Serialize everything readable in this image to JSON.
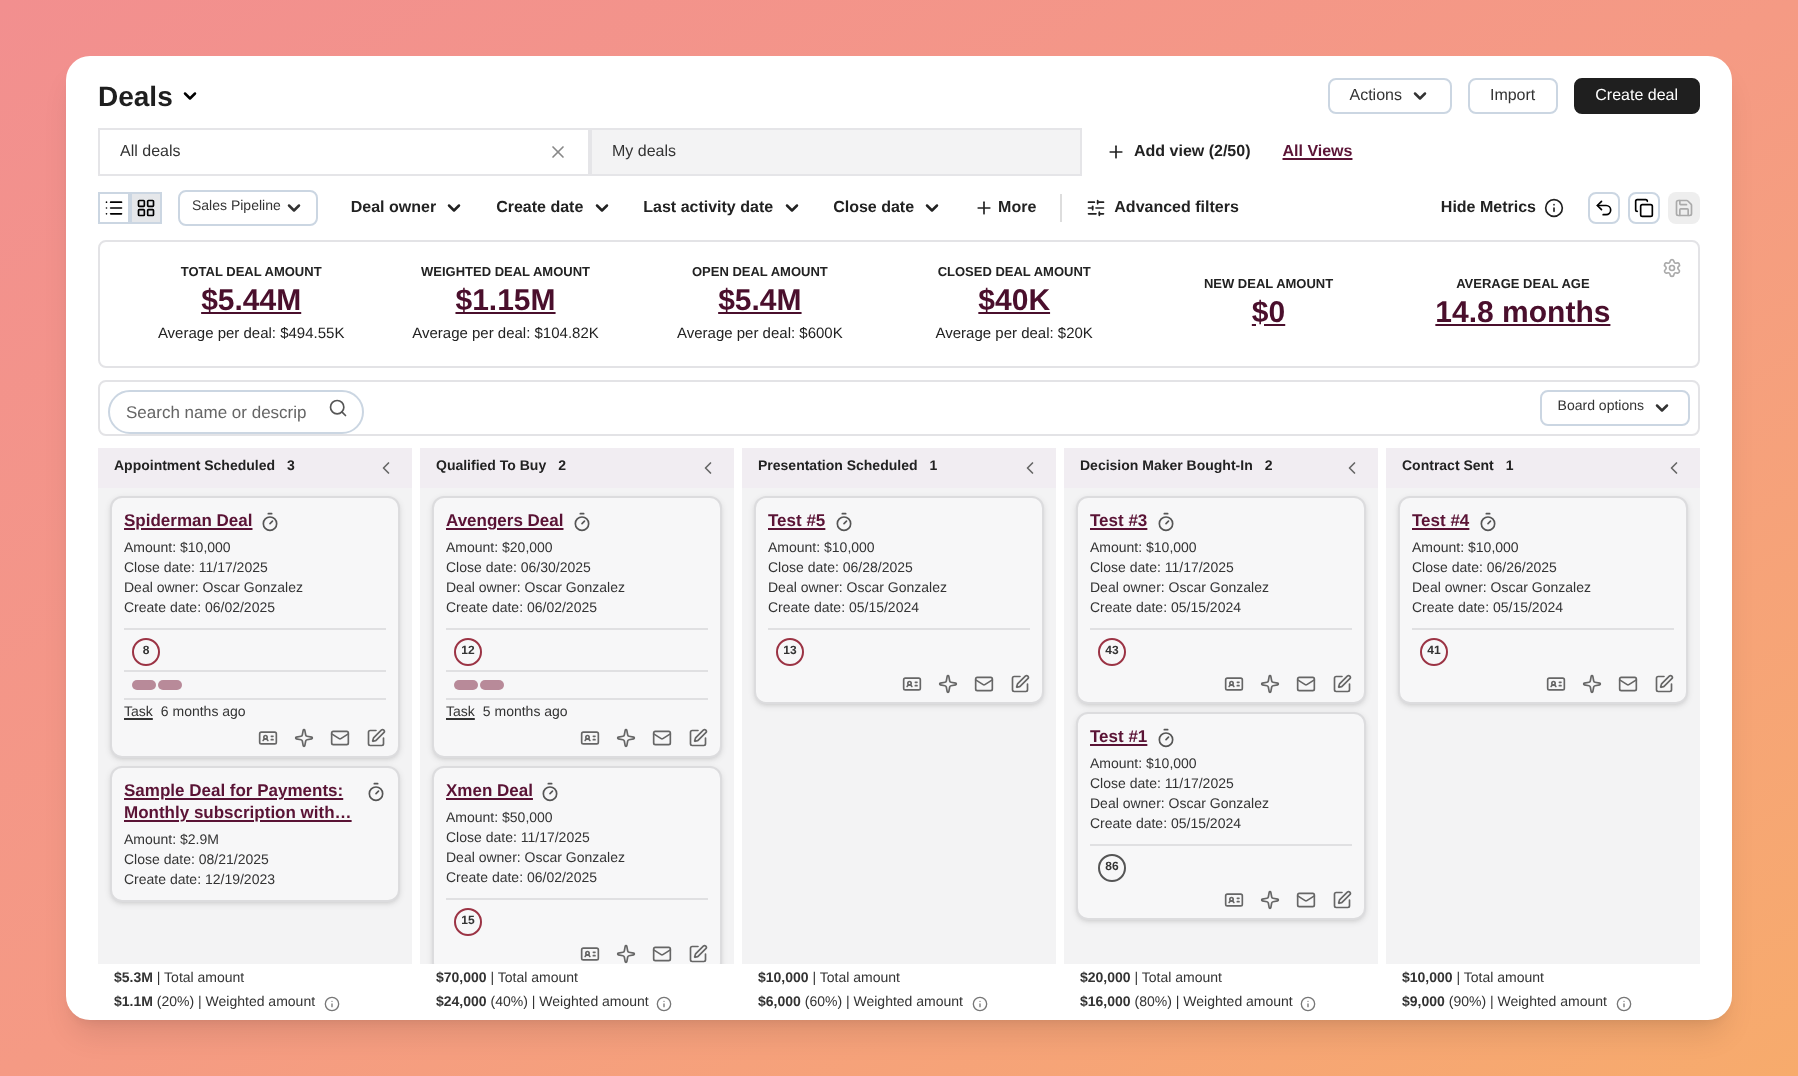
{
  "header": {
    "title": "Deals",
    "buttons": [
      {
        "label": "Actions",
        "kind": "menu"
      },
      {
        "label": "Import",
        "kind": "plain"
      },
      {
        "label": "Create deal",
        "kind": "primary"
      }
    ]
  },
  "views": {
    "tabs": [
      {
        "label": "All deals",
        "selected": true
      },
      {
        "label": "My deals",
        "selected": false
      }
    ],
    "add_view": "Add view (2/50)",
    "all_views": "All Views"
  },
  "toolbar": {
    "view_toggle": [
      {
        "kind": "list",
        "selected": false
      },
      {
        "kind": "board",
        "selected": true
      }
    ],
    "pipeline": "Sales Pipeline",
    "filters": [
      "Deal owner",
      "Create date",
      "Last activity date",
      "Close date"
    ],
    "more": "More",
    "advanced": "Advanced filters",
    "hide_metrics": "Hide Metrics"
  },
  "metrics": [
    {
      "label": "TOTAL DEAL AMOUNT",
      "value": "$5.44M",
      "sub": "Average per deal: $494.55K"
    },
    {
      "label": "WEIGHTED DEAL AMOUNT",
      "value": "$1.15M",
      "sub": "Average per deal: $104.82K"
    },
    {
      "label": "OPEN DEAL AMOUNT",
      "value": "$5.4M",
      "sub": "Average per deal: $600K"
    },
    {
      "label": "CLOSED DEAL AMOUNT",
      "value": "$40K",
      "sub": "Average per deal: $20K"
    },
    {
      "label": "NEW DEAL AMOUNT",
      "value": "$0"
    },
    {
      "label": "AVERAGE DEAL AGE",
      "value": "14.8 months"
    }
  ],
  "search": {
    "placeholder": "Search name or descrip"
  },
  "board_options": "Board options",
  "columns": [
    {
      "name": "Appointment Scheduled",
      "count": "3",
      "cards": [
        {
          "title": "Spiderman Deal",
          "lines": [
            "Amount: $10,000",
            "Close date: 11/17/2025",
            "Deal owner: Oscar Gonzalez",
            "Create date: 06/02/2025"
          ],
          "score": "8",
          "color": "#9b3344",
          "tags_shown": true,
          "activity": {
            "link": "Task",
            "text": "6 months ago"
          }
        },
        {
          "title": "Sample Deal for Payments: Monthly subscription with…",
          "lines": [
            "Amount: $2.9M",
            "Close date: 08/21/2025",
            "Create date: 12/19/2023"
          ]
        }
      ],
      "total": "**$5.3M** | Total amount",
      "weighted": "**$1.1M** (20%) | Weighted amount"
    },
    {
      "name": "Qualified To Buy",
      "count": "2",
      "cards": [
        {
          "title": "Avengers Deal",
          "lines": [
            "Amount: $20,000",
            "Close date: 06/30/2025",
            "Deal owner: Oscar Gonzalez",
            "Create date: 06/02/2025"
          ],
          "score": "12",
          "color": "#9b3344",
          "tags_shown": true,
          "activity": {
            "link": "Task",
            "text": "5 months ago"
          }
        },
        {
          "title": "Xmen Deal",
          "lines": [
            "Amount: $50,000",
            "Close date: 11/17/2025",
            "Deal owner: Oscar Gonzalez",
            "Create date: 06/02/2025"
          ],
          "score": "15",
          "color": "#9b3344"
        }
      ],
      "total": "**$70,000** | Total amount",
      "weighted": "**$24,000** (40%) | Weighted amount"
    },
    {
      "name": "Presentation Scheduled",
      "count": "1",
      "cards": [
        {
          "title": "Test #5",
          "lines": [
            "Amount: $10,000",
            "Close date: 06/28/2025",
            "Deal owner: Oscar Gonzalez",
            "Create date: 05/15/2024"
          ],
          "score": "13",
          "color": "#9b3344"
        }
      ],
      "total": "**$10,000** | Total amount",
      "weighted": "**$6,000** (60%) | Weighted amount"
    },
    {
      "name": "Decision Maker Bought-In",
      "count": "2",
      "cards": [
        {
          "title": "Test #3",
          "lines": [
            "Amount: $10,000",
            "Close date: 11/17/2025",
            "Deal owner: Oscar Gonzalez",
            "Create date: 05/15/2024"
          ],
          "score": "43",
          "color": "#9b3344"
        },
        {
          "title": "Test #1",
          "lines": [
            "Amount: $10,000",
            "Close date: 11/17/2025",
            "Deal owner: Oscar Gonzalez",
            "Create date: 05/15/2024"
          ],
          "score": "86",
          "color": "#555555"
        }
      ],
      "total": "**$20,000** | Total amount",
      "weighted": "**$16,000** (80%) | Weighted amount"
    },
    {
      "name": "Contract Sent",
      "count": "1",
      "cards": [
        {
          "title": "Test #4",
          "lines": [
            "Amount: $10,000",
            "Close date: 06/26/2025",
            "Deal owner: Oscar Gonzalez",
            "Create date: 05/15/2024"
          ],
          "score": "41",
          "color": "#9b3344"
        }
      ],
      "total": "**$10,000** | Total amount",
      "weighted": "**$9,000** (90%) | Weighted amount"
    }
  ]
}
